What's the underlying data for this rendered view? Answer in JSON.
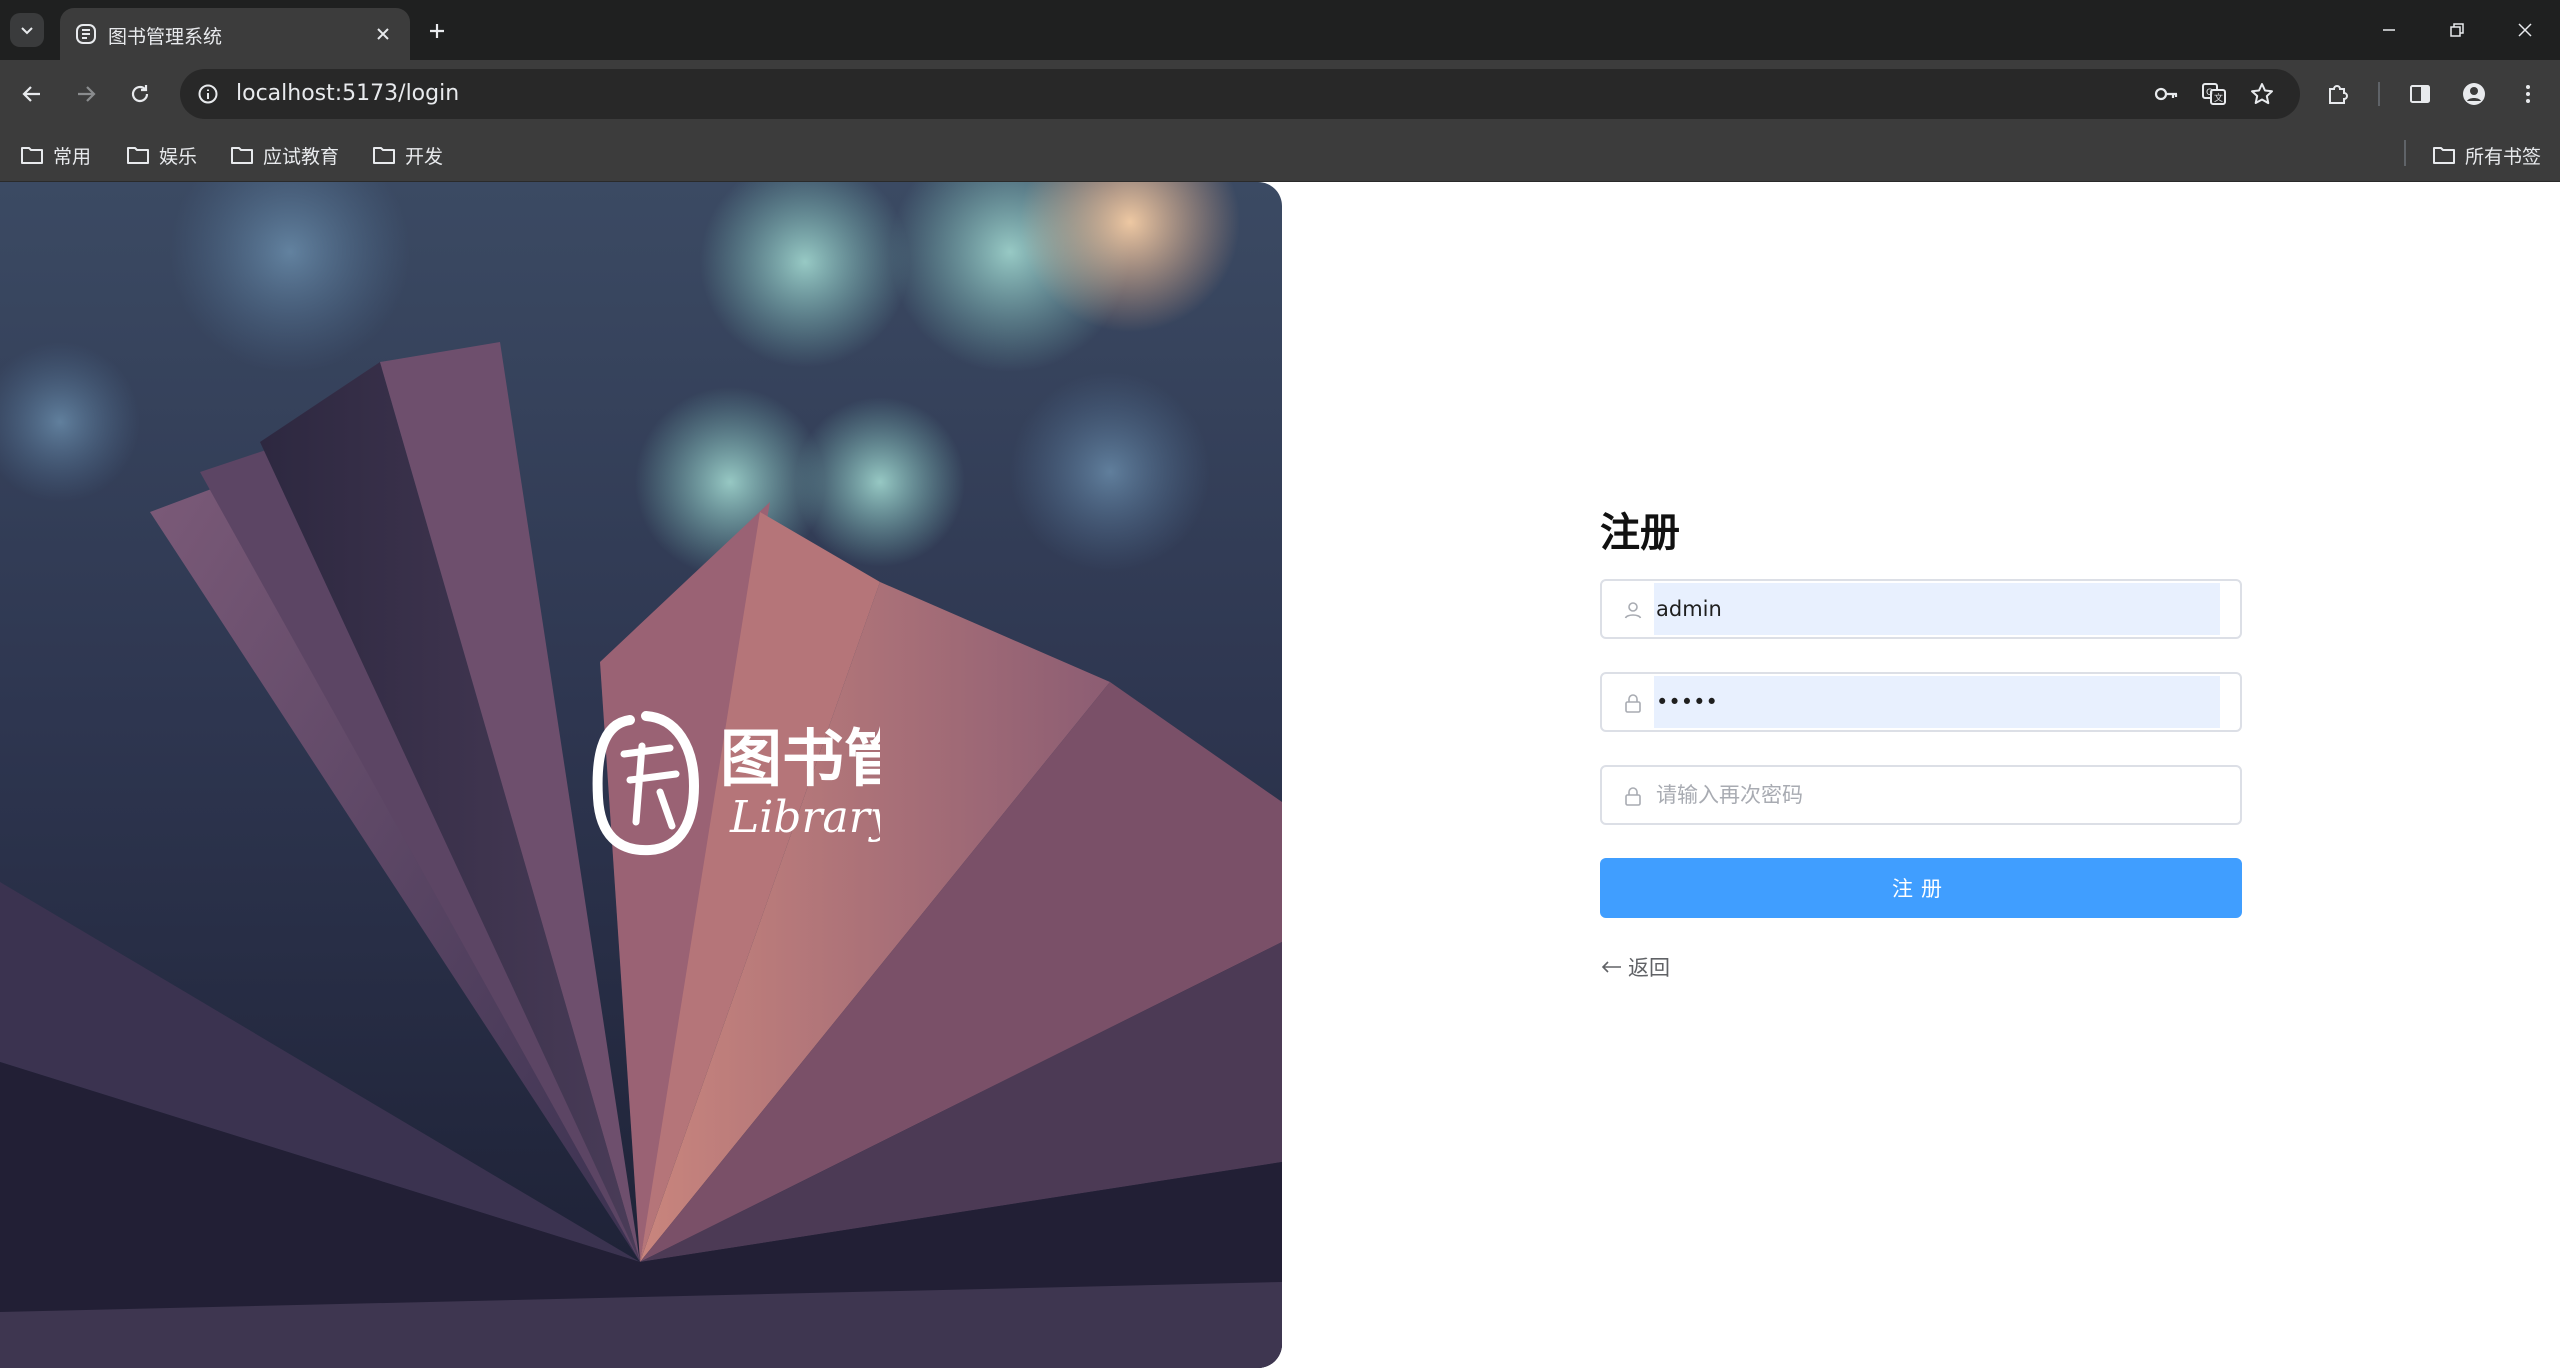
{
  "browser": {
    "tab_title": "图书管理系统",
    "url": "localhost:5173/login",
    "bookmarks": [
      {
        "label": "常用",
        "icon": "folder-icon"
      },
      {
        "label": "娱乐",
        "icon": "folder-icon"
      },
      {
        "label": "应试教育",
        "icon": "folder-icon"
      },
      {
        "label": "开发",
        "icon": "folder-icon"
      }
    ],
    "all_bookmarks_label": "所有书签"
  },
  "hero": {
    "logo_chars": "图书管",
    "logo_subtitle": "Library"
  },
  "register_form": {
    "title": "注册",
    "username": {
      "value": "admin",
      "icon": "user-icon"
    },
    "password": {
      "value": "•••••",
      "icon": "lock-icon"
    },
    "confirm_password": {
      "value": "",
      "placeholder": "请输入再次密码",
      "icon": "lock-icon"
    },
    "submit_label": "注册",
    "back_label": "返回"
  },
  "colors": {
    "primary": "#409eff",
    "autofill": "#e8f0fe",
    "chrome_dark": "#1f2020",
    "chrome_toolbar": "#3c3c3c"
  }
}
